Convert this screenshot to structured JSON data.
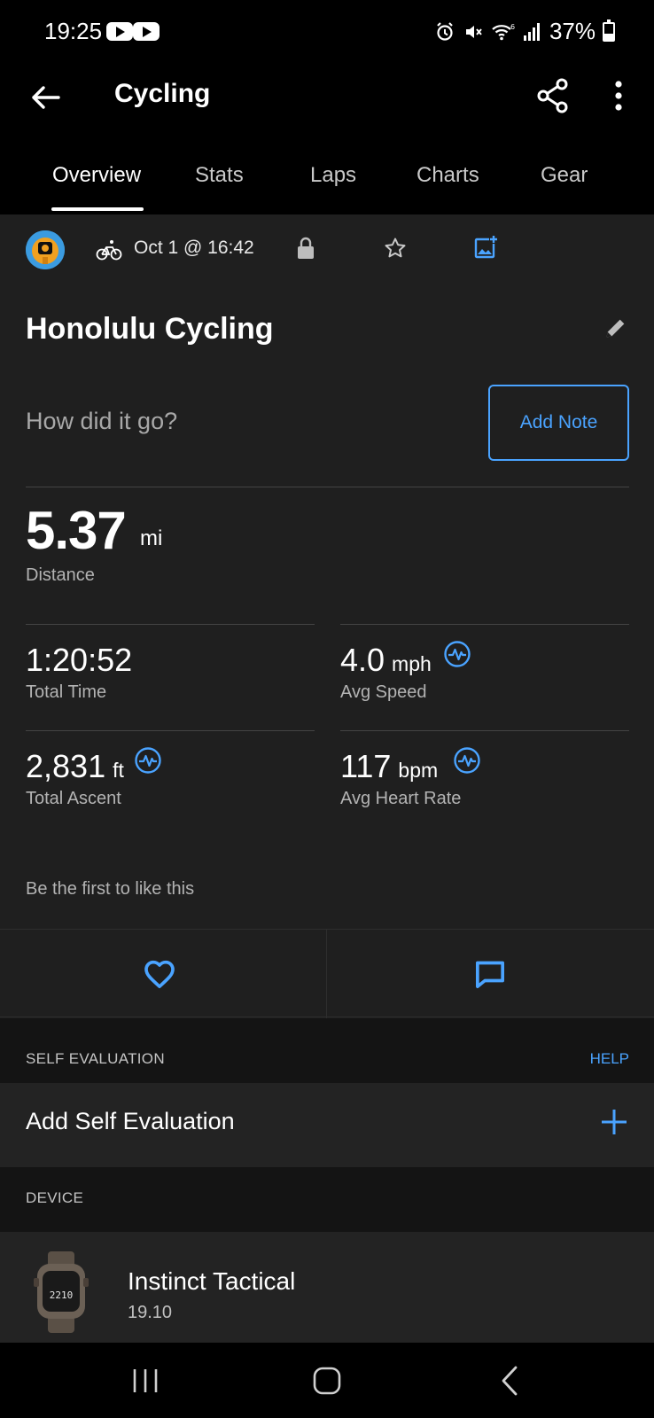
{
  "status_bar": {
    "time": "19:25",
    "battery": "37%"
  },
  "app_bar": {
    "title": "Cycling"
  },
  "tabs": [
    "Overview",
    "Stats",
    "Laps",
    "Charts",
    "Gear"
  ],
  "activity": {
    "date_time": "Oct 1 @ 16:42",
    "name": "Honolulu Cycling",
    "note_prompt": "How did it go?",
    "add_note_label": "Add Note"
  },
  "distance": {
    "value": "5.37",
    "unit": "mi",
    "label": "Distance"
  },
  "stats": [
    {
      "value": "1:20:52",
      "unit": "",
      "label": "Total Time"
    },
    {
      "value": "4.0",
      "unit": "mph",
      "label": "Avg Speed"
    },
    {
      "value": "2,831",
      "unit": "ft",
      "label": "Total Ascent"
    },
    {
      "value": "117",
      "unit": "bpm",
      "label": "Avg Heart Rate"
    }
  ],
  "likes_text": "Be the first to like this",
  "self_evaluation": {
    "section_label": "SELF EVALUATION",
    "help_label": "HELP",
    "add_label": "Add Self Evaluation"
  },
  "device": {
    "section_label": "DEVICE",
    "name": "Instinct Tactical",
    "version": "19.10",
    "watch_face_text": "2210"
  },
  "colors": {
    "accent": "#4aa3ff",
    "background": "#1f1f1f",
    "section_band": "#141414"
  },
  "icons": [
    "back-arrow-icon",
    "share-icon",
    "more-vert-icon",
    "cycling-icon",
    "lock-icon",
    "star-icon",
    "add-photo-icon",
    "edit-icon",
    "pulse-icon",
    "heart-icon",
    "comment-icon",
    "plus-icon"
  ]
}
